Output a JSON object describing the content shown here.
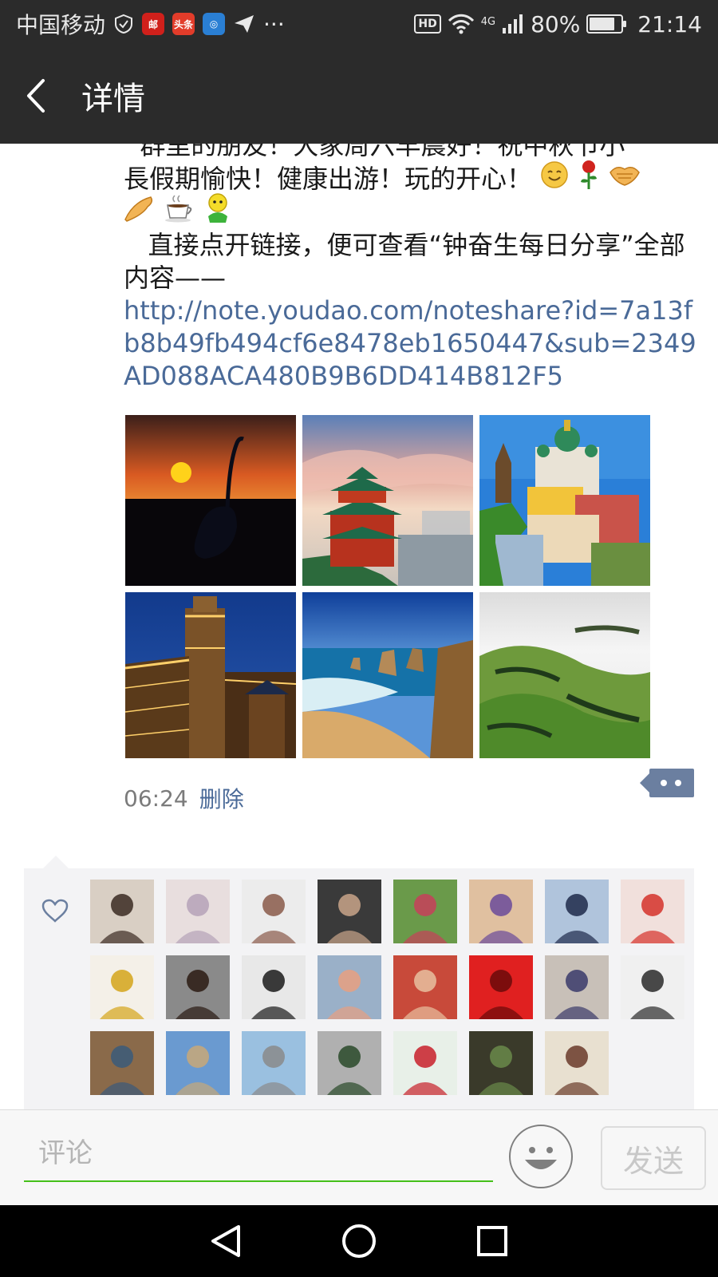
{
  "status_bar": {
    "carrier": "中国移动",
    "more": "···",
    "network": "4G",
    "hd": "HD",
    "battery_text": "80%",
    "battery_level": 0.8,
    "time": "21:14"
  },
  "header": {
    "title": "详情"
  },
  "post": {
    "text_partial": "  群里的朋友！大家周六早晨好！祝中秋节小",
    "text_line2": "長假期愉快！健康出游！玩的开心！",
    "text_para2": "   直接点开链接，便可查看“钟奋生每日分享”全部内容——",
    "link": "http://note.youdao.com/noteshare?id=7a13fb8b49fb494cf6e8478eb1650447&sub=2349AD088ACA480B9B6DD414B812F5",
    "emojis_line1": [
      "smile-emoji",
      "rose-emoji",
      "handshake-emoji"
    ],
    "emojis_line2": [
      "fist-emoji",
      "coffee-emoji",
      "chick-emoji"
    ],
    "photos": [
      "sunset-crane",
      "pagoda-river",
      "church-town",
      "castle-night",
      "coastal-rocks",
      "green-hills"
    ],
    "time": "06:24",
    "delete_label": "删除"
  },
  "likes": {
    "avatars": [
      "avatar-1",
      "avatar-2",
      "avatar-3",
      "avatar-4",
      "avatar-5",
      "avatar-6",
      "avatar-7",
      "avatar-8",
      "avatar-9",
      "avatar-10",
      "avatar-11",
      "avatar-12",
      "avatar-13",
      "avatar-14",
      "avatar-15",
      "avatar-16",
      "avatar-17",
      "avatar-18",
      "avatar-19",
      "avatar-20",
      "avatar-21",
      "avatar-22",
      "avatar-23"
    ]
  },
  "comment": {
    "placeholder": "评论",
    "send_label": "发送"
  },
  "colors": {
    "bar": "#2b2b2b",
    "link": "#4a6a98",
    "accent_green": "#45c01a"
  }
}
